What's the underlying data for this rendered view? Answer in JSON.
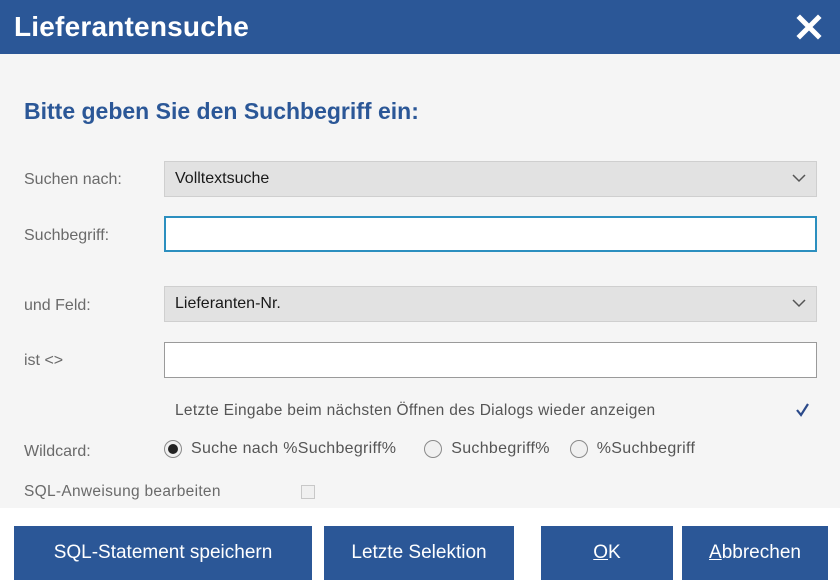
{
  "window": {
    "title": "Lieferantensuche",
    "close_icon": "close-icon"
  },
  "heading": "Bitte geben Sie den Suchbegriff ein:",
  "form": {
    "search_by_label": "Suchen nach:",
    "search_by_value": "Volltextsuche",
    "search_term_label": "Suchbegriff:",
    "search_term_value": "",
    "field_label": "und Feld:",
    "field_value": "Lieferanten-Nr.",
    "not_equal_label": "ist <>",
    "not_equal_value": "",
    "remember_label": "Letzte Eingabe beim nächsten Öffnen des Dialogs wieder anzeigen",
    "remember_checked": true,
    "wildcard_label": "Wildcard:",
    "wildcard_options": [
      {
        "label": "Suche nach %Suchbegriff%",
        "selected": true
      },
      {
        "label": "Suchbegriff%",
        "selected": false
      },
      {
        "label": "%Suchbegriff",
        "selected": false
      }
    ],
    "sql_edit_label": "SQL-Anweisung bearbeiten",
    "sql_edit_checked": false
  },
  "buttons": {
    "save_sql": "SQL-Statement speichern",
    "last_selection": "Letzte Selektion",
    "ok_prefix": "",
    "ok_underline": "O",
    "ok_rest": "K",
    "cancel_underline": "A",
    "cancel_rest": "bbrechen"
  },
  "colors": {
    "accent": "#2b5797",
    "focus_border": "#2c8fbf",
    "background": "#f5f5f5"
  }
}
